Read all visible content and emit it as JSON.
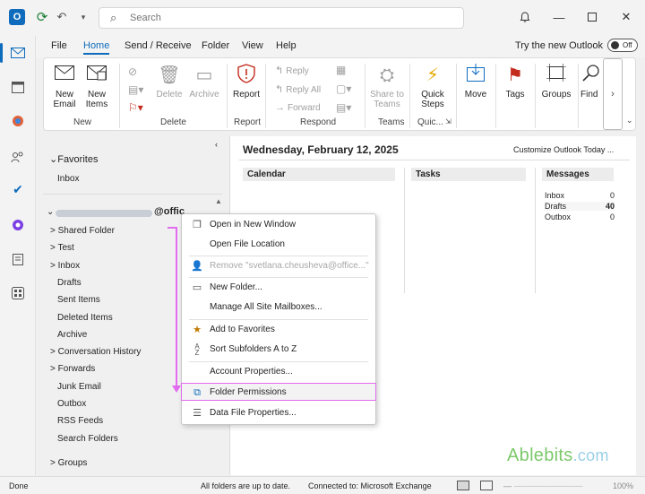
{
  "titlebar": {
    "search_placeholder": "Search",
    "app_logo_text": "O"
  },
  "menu": {
    "tabs": [
      "File",
      "Home",
      "Send / Receive",
      "Folder",
      "View",
      "Help"
    ],
    "try_new": "Try the new Outlook",
    "toggle_label": "Off"
  },
  "ribbon": {
    "new_email": "New\nEmail",
    "new_items": "New\nItems",
    "group_new": "New",
    "delete": "Delete",
    "archive": "Archive",
    "group_delete": "Delete",
    "report": "Report",
    "group_report": "Report",
    "reply": "Reply",
    "reply_all": "Reply All",
    "forward": "Forward",
    "group_respond": "Respond",
    "share_to_teams": "Share to\nTeams",
    "group_teams": "Teams",
    "quick_steps": "Quick\nSteps",
    "group_quick": "Quic...",
    "move": "Move",
    "tags": "Tags",
    "groups": "Groups",
    "find": "Find"
  },
  "folders": {
    "favorites": "Favorites",
    "inbox_fav": "Inbox",
    "account_suffix": "@offic",
    "items": [
      {
        "label": "> Shared Folder",
        "indent": 0
      },
      {
        "label": "> Test",
        "indent": 0
      },
      {
        "label": "> Inbox",
        "indent": 0
      },
      {
        "label": "Drafts",
        "indent": 1
      },
      {
        "label": "Sent Items",
        "indent": 1
      },
      {
        "label": "Deleted Items",
        "indent": 1
      },
      {
        "label": "Archive",
        "indent": 1
      },
      {
        "label": "> Conversation History",
        "indent": 0
      },
      {
        "label": "> Forwards",
        "indent": 0
      },
      {
        "label": "Junk Email",
        "indent": 1
      },
      {
        "label": "Outbox",
        "indent": 1
      },
      {
        "label": "RSS Feeds",
        "indent": 1
      },
      {
        "label": "Search Folders",
        "indent": 1
      }
    ],
    "groups": "> Groups"
  },
  "today": {
    "date": "Wednesday, February 12, 2025",
    "customize": "Customize Outlook Today ...",
    "calendar": "Calendar",
    "tasks": "Tasks",
    "messages": "Messages",
    "rows": [
      {
        "label": "Inbox",
        "count": "0"
      },
      {
        "label": "Drafts",
        "count": "40"
      },
      {
        "label": "Outbox",
        "count": "0"
      }
    ]
  },
  "context_menu": {
    "open_new_window": "Open in New Window",
    "open_file_location": "Open File Location",
    "remove": "Remove \"svetlana.cheusheva@office...\"",
    "new_folder": "New Folder...",
    "manage_mailboxes": "Manage All Site Mailboxes...",
    "add_favorites": "Add to Favorites",
    "sort_subfolders": "Sort Subfolders A to Z",
    "account_properties": "Account Properties...",
    "folder_permissions": "Folder Permissions",
    "data_file_properties": "Data File Properties..."
  },
  "statusbar": {
    "left": "Done",
    "middle": "All folders are up to date.",
    "connected": "Connected to: Microsoft Exchange",
    "zoom": "100%"
  },
  "watermark": {
    "brand": "Ablebits",
    "suffix": ".com"
  },
  "colors": {
    "accent": "#0f6cbd",
    "highlight": "#e36bf0",
    "brand_green": "#7cc96b"
  }
}
